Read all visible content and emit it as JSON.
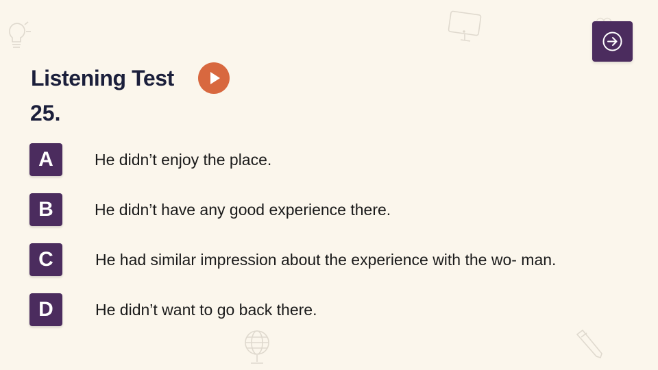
{
  "header": {
    "title": "Listening Test",
    "play_icon": "play-icon",
    "next_icon": "arrow-right-circle-icon"
  },
  "question": {
    "number": "25.",
    "options": [
      {
        "letter": "A",
        "text": "He didn’t enjoy the place."
      },
      {
        "letter": "B",
        "text": "He didn’t have any good experience there."
      },
      {
        "letter": "C",
        "text": "He had similar impression about the experience with the wo- man."
      },
      {
        "letter": "D",
        "text": "He didn’t want to go back there."
      }
    ]
  },
  "decorations": [
    "lightbulb-icon",
    "monitor-icon",
    "heart-icon",
    "globe-icon",
    "pencil-icon"
  ],
  "colors": {
    "background": "#fbf6ec",
    "accent_purple": "#4b2c5e",
    "play_orange": "#d8683f",
    "heading": "#1b1f3b"
  }
}
